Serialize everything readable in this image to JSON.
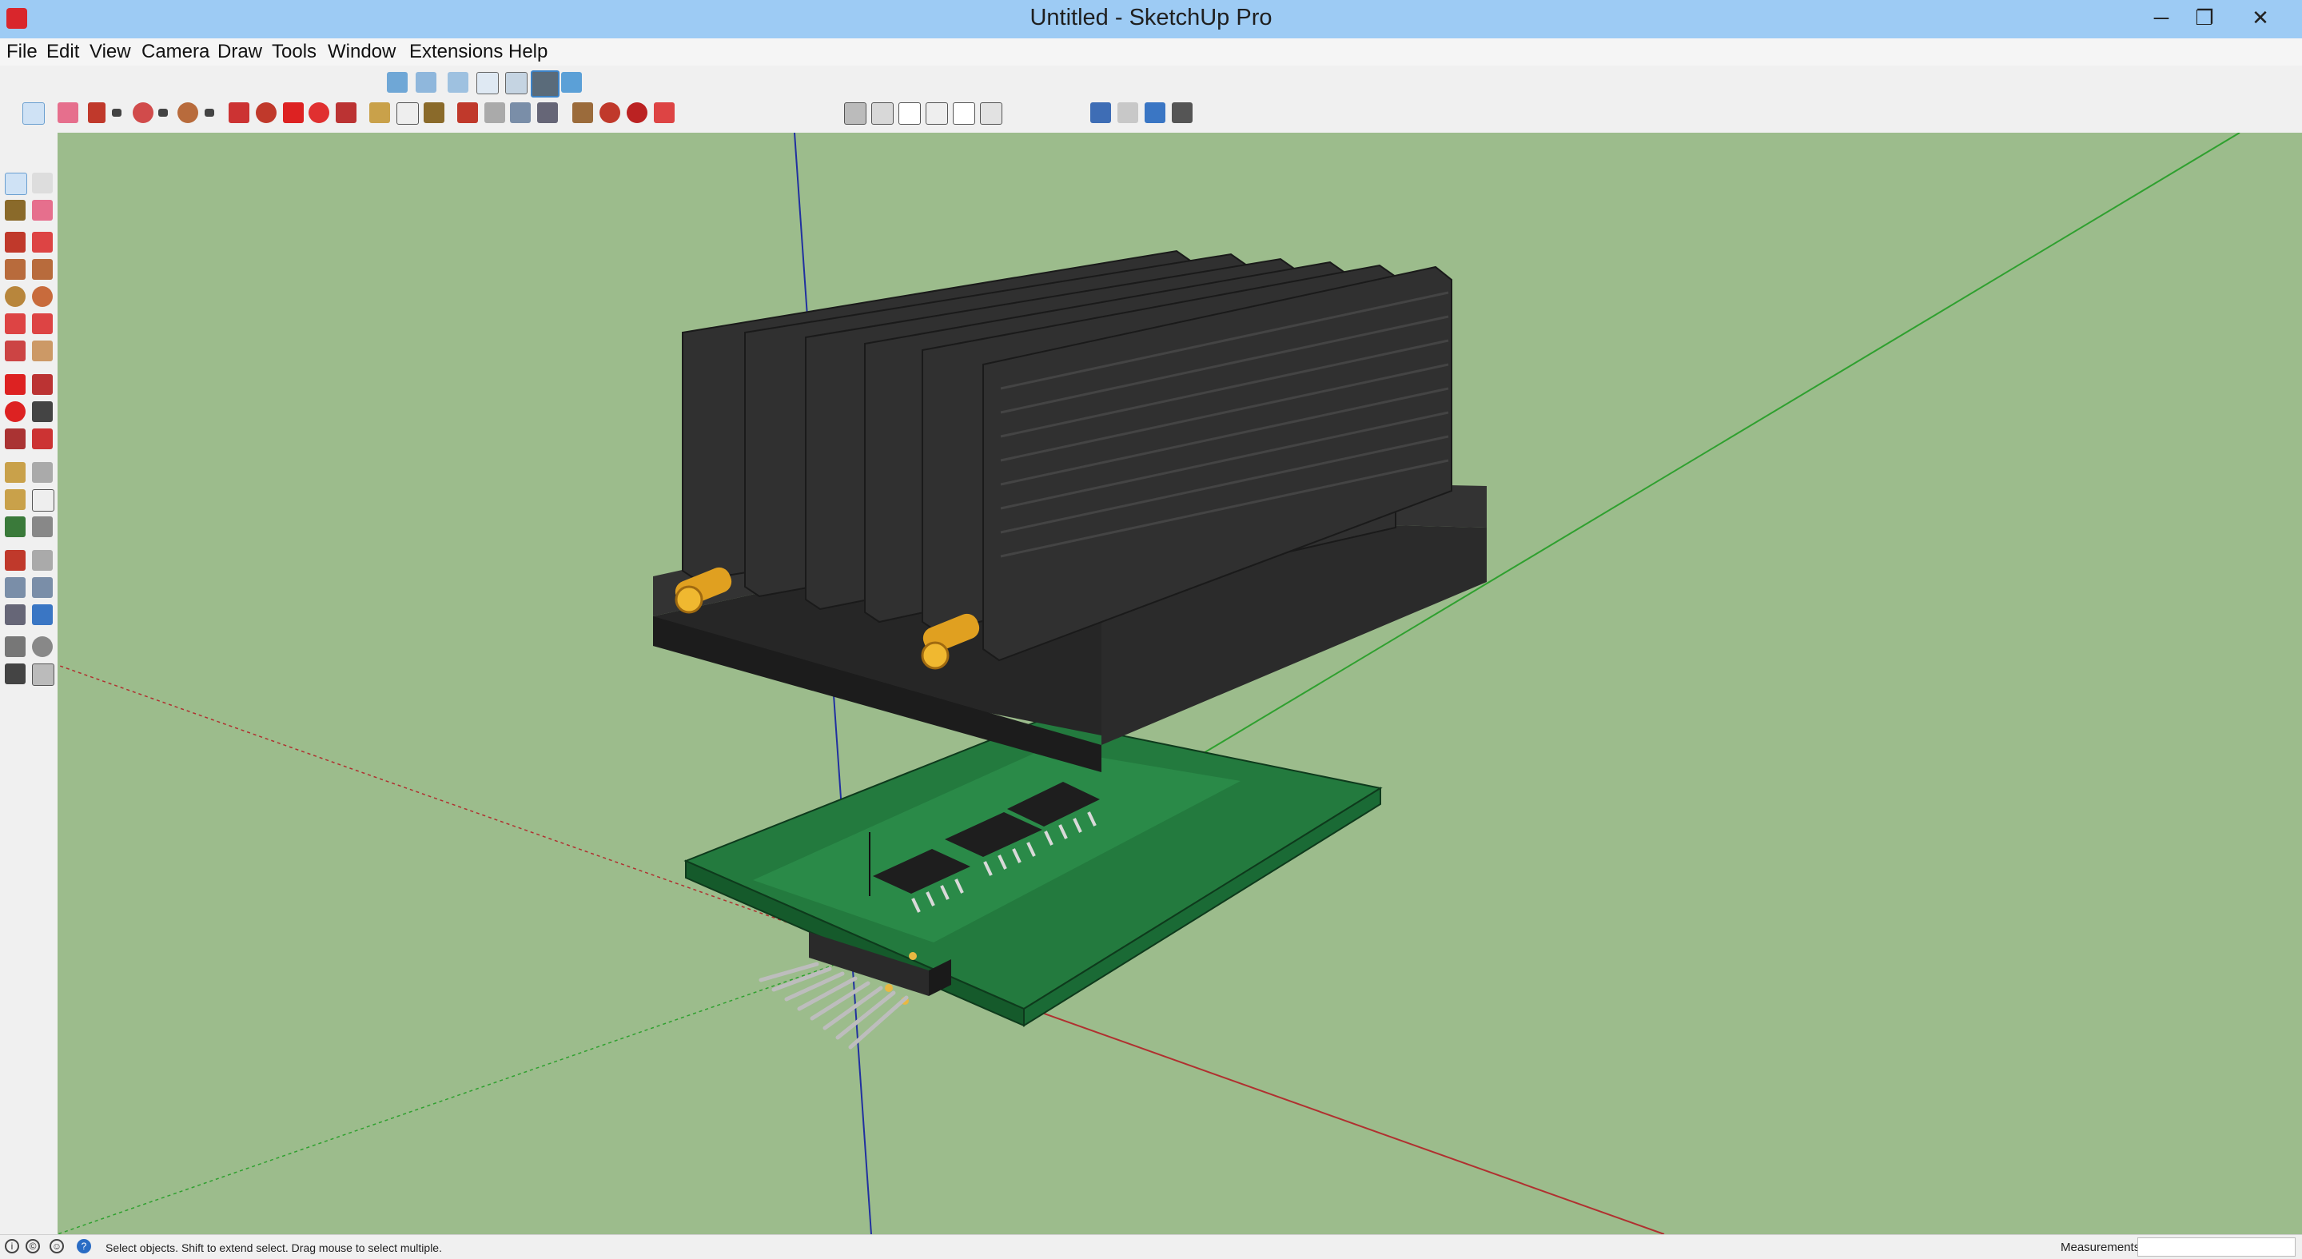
{
  "window": {
    "title": "Untitled - SketchUp Pro",
    "minimize": "─",
    "restore": "❐",
    "close": "✕"
  },
  "menu": [
    "File",
    "Edit",
    "View",
    "Camera",
    "Draw",
    "Tools",
    "Window",
    "Extensions",
    "Help"
  ],
  "status": {
    "hint": "Select objects. Shift to extend select. Drag mouse to select multiple.",
    "measurements_label": "Measurements",
    "measurements_value": ""
  },
  "colors": {
    "accent": "#9dcbf4",
    "viewport": "#9cbc8c",
    "heatsink": "#2e2e2e",
    "pcb": "#1f7a3e",
    "pins": "#e0a020"
  },
  "toolbars": {
    "views": [
      "iso-view-icon",
      "top-view-icon",
      "front-view-icon",
      "right-view-icon",
      "back-view-icon",
      "left-view-icon",
      "bottom-view-icon"
    ],
    "main": [
      "select-icon",
      "eraser-icon",
      "pencil-icon",
      "line-dropdown-icon",
      "arc-icon",
      "arc-dropdown-icon",
      "circle-icon",
      "circle-dropdown-icon",
      "push-pull-icon",
      "follow-me-icon",
      "move-icon",
      "rotate-icon",
      "scale-icon",
      "tape-icon",
      "text-icon",
      "paint-icon",
      "orbit-icon",
      "pan-icon",
      "zoom-icon",
      "zoom-extents-icon",
      "warehouse-icon",
      "extension-warehouse-icon",
      "layout-icon",
      "send-to-layout-icon"
    ],
    "styles": [
      "xray-icon",
      "back-edges-icon",
      "wireframe-icon",
      "hidden-line-icon",
      "shaded-icon",
      "shaded-textures-icon"
    ],
    "extras": [
      "sandbox-icon",
      "grid-icon",
      "component-icon",
      "section-icon"
    ]
  },
  "left_tools": [
    "select-icon",
    "component-icon",
    "paint-icon",
    "eraser-icon",
    "pencil-icon",
    "freehand-icon",
    "rectangle-icon",
    "rotated-rect-icon",
    "circle-icon",
    "polygon-icon",
    "arc-icon",
    "2pt-arc-icon",
    "3pt-arc-icon",
    "pie-icon",
    "move-icon",
    "push-pull-icon",
    "rotate-icon",
    "follow-me-icon",
    "scale-icon",
    "offset-icon",
    "tape-icon",
    "dimension-icon",
    "protractor-icon",
    "text-icon",
    "axes-icon",
    "3d-text-icon",
    "orbit-icon",
    "pan-icon",
    "zoom-icon",
    "zoom-window-icon",
    "zoom-extents-icon",
    "previous-icon",
    "position-camera-icon",
    "look-around-icon",
    "walk-icon",
    "section-plane-icon"
  ],
  "status_icons": [
    "info-icon",
    "credit-icon",
    "user-icon",
    "help-icon"
  ]
}
